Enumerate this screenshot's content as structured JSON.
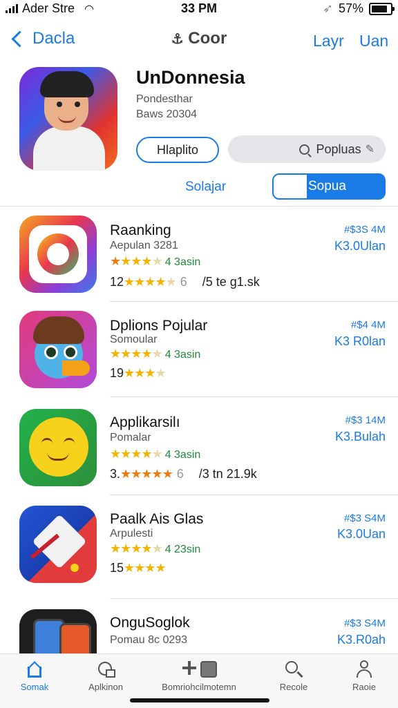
{
  "status": {
    "carrier": "Ader Stre",
    "time": "33 PM",
    "battery": "57%"
  },
  "nav": {
    "back": "Dacla",
    "title": "Coor",
    "right1": "Layr",
    "right2": "Uan"
  },
  "hero": {
    "title": "UnDonnesia",
    "subtitle": "Pondesthar",
    "subtitle2": "Baws 20304",
    "button": "Hlaplito",
    "search": "Popluas",
    "tab1": "Solajar",
    "tab2": "Sopua"
  },
  "apps": [
    {
      "name": "Raanking",
      "sub": "Aepulan 3281",
      "rating": "4 3asin",
      "meta_num": "12",
      "meta_extra": "6",
      "meta_text": "/5 te g1.sk",
      "price1": "#$3S 4M",
      "price2": "K3.0Ulan"
    },
    {
      "name": "Dplions Pojular",
      "sub": "Somoular",
      "rating": "4 3asin",
      "meta_num": "19",
      "meta_extra": "",
      "meta_text": "",
      "price1": "#$4 4M",
      "price2": "K3 R0lan"
    },
    {
      "name": "Applikarsilı",
      "sub": "Pomalar",
      "rating": "4 3asin",
      "meta_num": "3.",
      "meta_extra": "6",
      "meta_text": "/3 tn 21.9k",
      "price1": "#$3 14M",
      "price2": "K3.Bulah"
    },
    {
      "name": "Paalk Ais Glas",
      "sub": "Arpulesti",
      "rating": "4 23sin",
      "meta_num": "15",
      "meta_extra": "",
      "meta_text": "",
      "price1": "#$3 S4M",
      "price2": "K3.0Uan"
    },
    {
      "name": "OnguSoglok",
      "sub": "Pomau 8c 0293",
      "rating": "",
      "meta_num": "",
      "meta_extra": "",
      "meta_text": "",
      "price1": "#$3 S4M",
      "price2": "K3.R0ah"
    }
  ],
  "tabbar": [
    {
      "label": "Somak",
      "icon": "home-icon"
    },
    {
      "label": "Aplkinon",
      "icon": "apps-icon"
    },
    {
      "label": "Bomriohcilmotemn",
      "icon": "games-icon"
    },
    {
      "label": "Recole",
      "icon": "search-icon"
    },
    {
      "label": "Raoie",
      "icon": "person-icon"
    }
  ],
  "colors": {
    "accent": "#1a7be6",
    "star": "#f2b400",
    "rating_text": "#1f8a3a"
  }
}
